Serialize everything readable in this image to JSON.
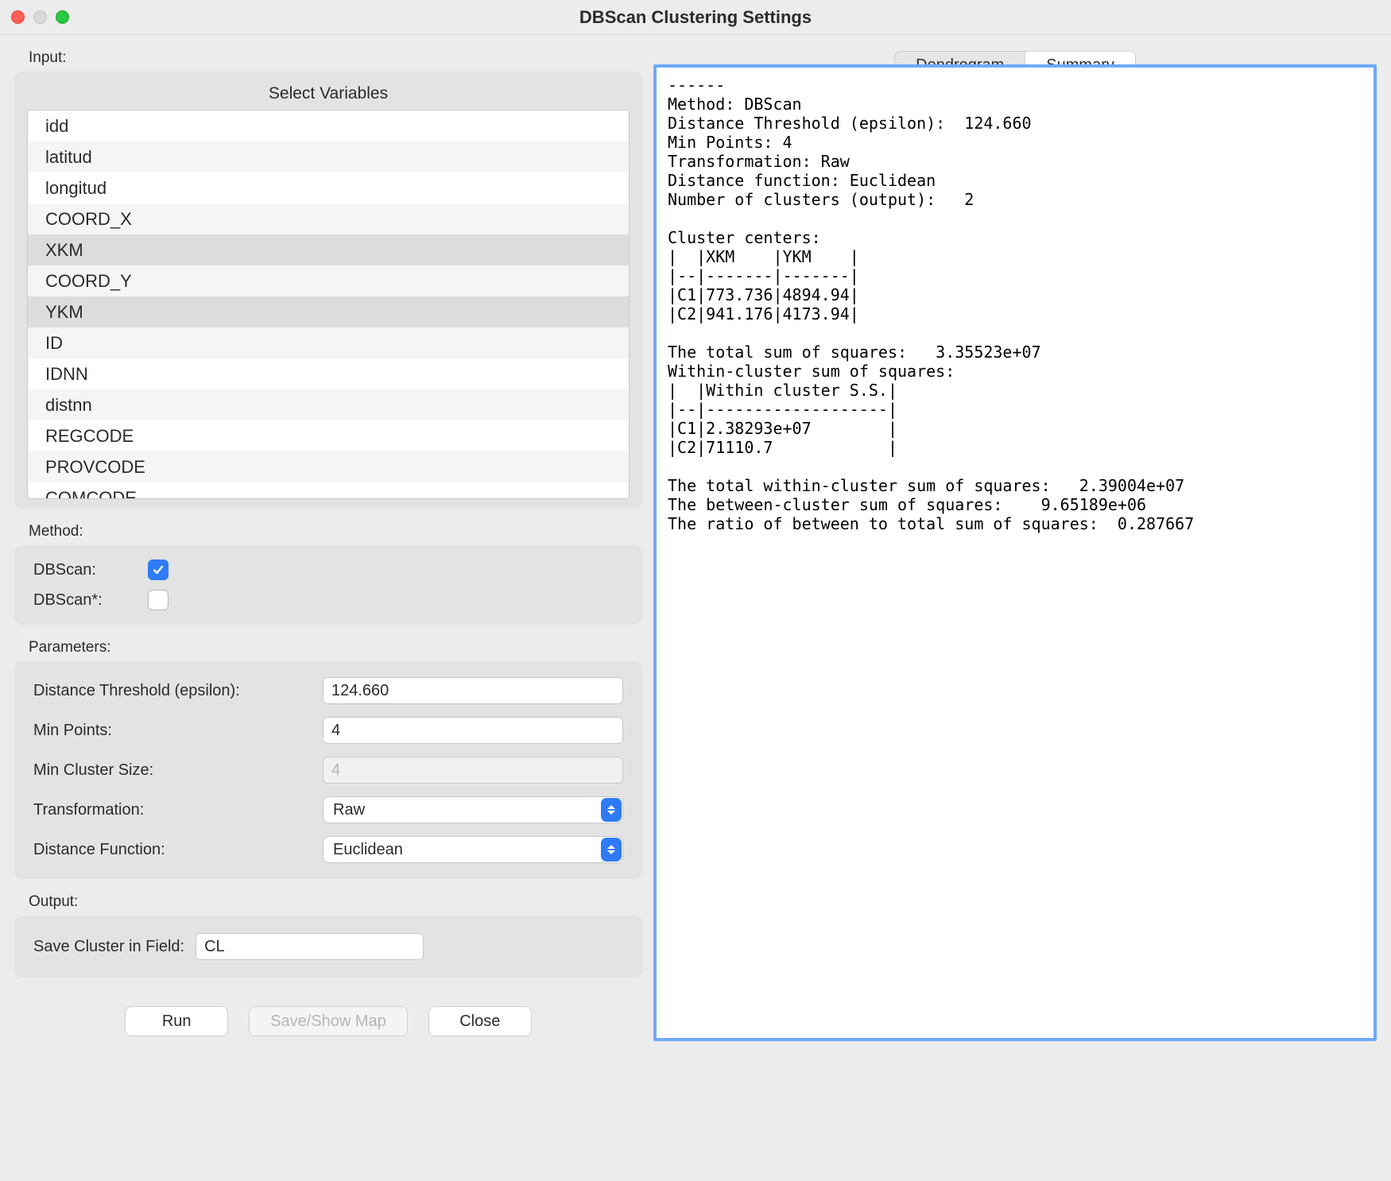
{
  "window": {
    "title": "DBScan Clustering Settings"
  },
  "input": {
    "section_label": "Input:",
    "list_title": "Select Variables",
    "items": [
      {
        "label": "idd",
        "selected": false
      },
      {
        "label": "latitud",
        "selected": false
      },
      {
        "label": "longitud",
        "selected": false
      },
      {
        "label": "COORD_X",
        "selected": false
      },
      {
        "label": "XKM",
        "selected": true
      },
      {
        "label": "COORD_Y",
        "selected": false
      },
      {
        "label": "YKM",
        "selected": true
      },
      {
        "label": "ID",
        "selected": false
      },
      {
        "label": "IDNN",
        "selected": false
      },
      {
        "label": "distnn",
        "selected": false
      },
      {
        "label": "REGCODE",
        "selected": false
      },
      {
        "label": "PROVCODE",
        "selected": false
      },
      {
        "label": "COMCODE",
        "selected": false
      }
    ]
  },
  "method": {
    "section_label": "Method:",
    "dbscan_label": "DBScan:",
    "dbscan_checked": true,
    "dbscan_star_label": "DBScan*:",
    "dbscan_star_checked": false
  },
  "parameters": {
    "section_label": "Parameters:",
    "epsilon_label": "Distance Threshold (epsilon):",
    "epsilon_value": "124.660",
    "min_pts_label": "Min Points:",
    "min_pts_value": "4",
    "min_cluster_label": "Min Cluster Size:",
    "min_cluster_value": "4",
    "transform_label": "Transformation:",
    "transform_value": "Raw",
    "distfn_label": "Distance Function:",
    "distfn_value": "Euclidean"
  },
  "output": {
    "section_label": "Output:",
    "save_label": "Save Cluster in Field:",
    "save_value": "CL"
  },
  "buttons": {
    "run": "Run",
    "save_map": "Save/Show Map",
    "close": "Close"
  },
  "tabs": {
    "dendrogram": "Dendrogram",
    "summary": "Summary",
    "active": "summary"
  },
  "summary_text": "------\nMethod: DBScan\nDistance Threshold (epsilon):  124.660\nMin Points: 4\nTransformation: Raw\nDistance function: Euclidean\nNumber of clusters (output):   2\n\nCluster centers:\n|  |XKM    |YKM    |\n|--|-------|-------|\n|C1|773.736|4894.94|\n|C2|941.176|4173.94|\n\nThe total sum of squares:   3.35523e+07\nWithin-cluster sum of squares:\n|  |Within cluster S.S.|\n|--|-------------------|\n|C1|2.38293e+07        |\n|C2|71110.7            |\n\nThe total within-cluster sum of squares:   2.39004e+07\nThe between-cluster sum of squares:    9.65189e+06\nThe ratio of between to total sum of squares:  0.287667\n"
}
